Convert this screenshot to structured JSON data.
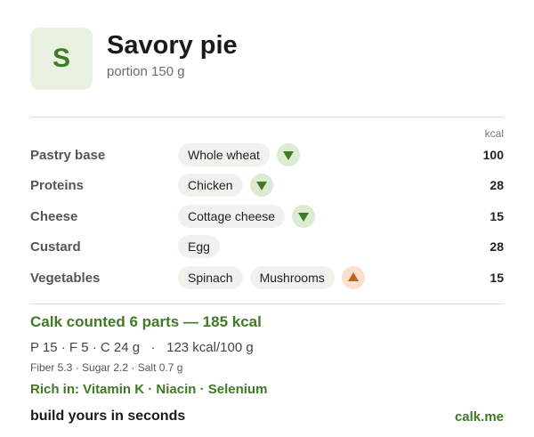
{
  "header": {
    "logo_letter": "S",
    "title": "Savory pie",
    "subtitle": "portion 150 g"
  },
  "table": {
    "kcal_header": "kcal",
    "rows": [
      {
        "label": "Pastry base",
        "chips": [
          "Whole wheat"
        ],
        "trend": "down",
        "kcal": "100"
      },
      {
        "label": "Proteins",
        "chips": [
          "Chicken"
        ],
        "trend": "down",
        "kcal": "28"
      },
      {
        "label": "Cheese",
        "chips": [
          "Cottage cheese"
        ],
        "trend": "down",
        "kcal": "15"
      },
      {
        "label": "Custard",
        "chips": [
          "Egg"
        ],
        "trend": "",
        "kcal": "28"
      },
      {
        "label": "Vegetables",
        "chips": [
          "Spinach",
          "Mushrooms"
        ],
        "trend": "up",
        "kcal": "15"
      }
    ]
  },
  "footer": {
    "summary": "Calk counted 6 parts — 185 kcal",
    "macros": "P 15 · F 5 · C 24 g   ·   123 kcal/100 g",
    "minor": "Fiber 5.3 · Sugar 2.2 · Salt 0.7 g",
    "rich_in": "Rich in: Vitamin K · Niacin · Selenium",
    "tagline": "build yours in seconds",
    "brand": "calk.me"
  },
  "colors": {
    "accent_green": "#3f7a26",
    "down_badge_bg": "#dcebd2",
    "up_badge_bg": "#f9e0cf",
    "up_arrow": "#c4621c"
  },
  "icons": {
    "trend_down": "triangle-down-icon",
    "trend_up": "triangle-up-icon"
  }
}
